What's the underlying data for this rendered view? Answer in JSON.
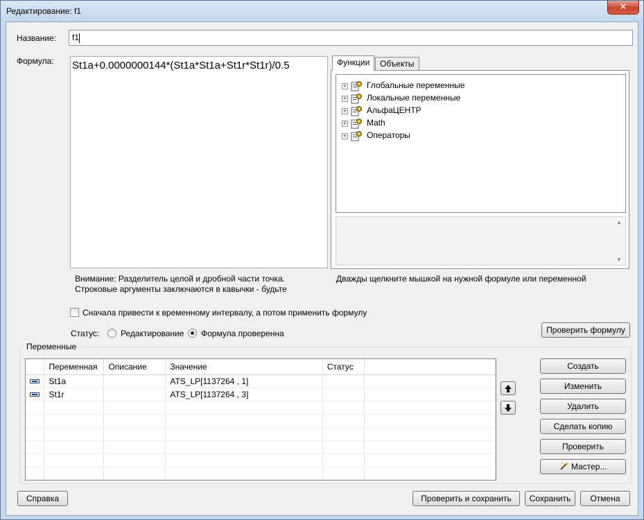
{
  "window": {
    "title": "Редактирование: f1",
    "close_symbol": "✕"
  },
  "name_field": {
    "label": "Название:",
    "value": "f1"
  },
  "formula": {
    "label": "Формула:",
    "value": "St1a+0.0000000144*(St1a*St1a+St1r*St1r)/0.5"
  },
  "tabs": [
    {
      "label": "Функции",
      "active": true
    },
    {
      "label": "Объекты",
      "active": false
    }
  ],
  "tree": {
    "items": [
      {
        "label": "Глобальные переменные"
      },
      {
        "label": "Локальные переменные"
      },
      {
        "label": "АльфаЦЕНТР"
      },
      {
        "label": "Math"
      },
      {
        "label": "Операторы"
      }
    ]
  },
  "notes": {
    "separator": "Внимание: Разделитель целой и дробной части точка.",
    "strings": "Строковые аргументы заключаются в кавычки - будьте",
    "hint": "Дважды щелкните мышкой на нужной формуле или переменной"
  },
  "interval_checkbox": {
    "label": "Сначала привести к временному интервалу, а потом применить формулу",
    "checked": false
  },
  "status": {
    "label": "Статус:",
    "options": [
      {
        "label": "Редактирование",
        "checked": false
      },
      {
        "label": "Формула проверенна",
        "checked": true
      }
    ]
  },
  "check_formula_button": "Проверить формулу",
  "variables": {
    "group_label": "Переменные",
    "columns": [
      "",
      "Переменная",
      "Описание",
      "Значение",
      "Статус"
    ],
    "rows": [
      {
        "name": "St1a",
        "description": "",
        "value": "ATS_LP[1137264 , 1]",
        "status": ""
      },
      {
        "name": "St1r",
        "description": "",
        "value": "ATS_LP[1137264 , 3]",
        "status": ""
      }
    ],
    "buttons": {
      "create": "Создать",
      "edit": "Изменить",
      "delete": "Удалить",
      "copy": "Сделать копию",
      "check": "Проверить",
      "wizard": "Мастер..."
    }
  },
  "footer": {
    "help": "Справка",
    "check_save": "Проверить и сохранить",
    "save": "Сохранить",
    "cancel": "Отмена"
  }
}
